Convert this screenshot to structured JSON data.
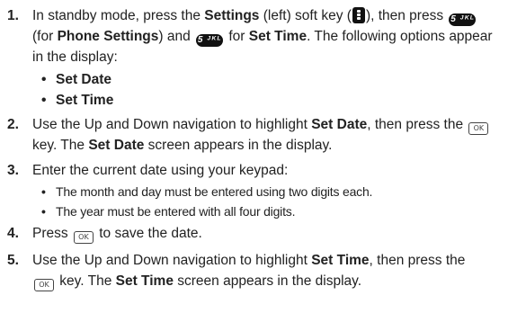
{
  "steps": [
    {
      "num": "1.",
      "parts": {
        "a": "In standby mode, press the ",
        "b": "Settings",
        "c": " (left) soft key (",
        "d": "), then press ",
        "e": "(for ",
        "f": "Phone Settings",
        "g": ") and ",
        "h": " for ",
        "i": "Set Time",
        "j": ". The following options appear",
        "k": "in the display:"
      },
      "bullets": [
        "Set Date",
        "Set Time"
      ]
    },
    {
      "num": "2.",
      "parts": {
        "a": "Use the Up and Down navigation to highlight ",
        "b": "Set Date",
        "c": ", then press the ",
        "d": "key. The ",
        "e": "Set Date",
        "f": " screen appears in the display."
      }
    },
    {
      "num": "3.",
      "text": "Enter the current date using your keypad:",
      "bullets": [
        "The month and day must be entered using two digits each.",
        "The year must be entered with all four digits."
      ]
    },
    {
      "num": "4.",
      "parts": {
        "a": "Press ",
        "b": " to save the date."
      }
    },
    {
      "num": "5.",
      "parts": {
        "a": "Use the Up and Down navigation to highlight ",
        "b": "Set Time",
        "c": ", then press the",
        "d": " key. The ",
        "e": "Set Time",
        "f": " screen appears in the display."
      }
    }
  ],
  "icons": {
    "key5_label": "5 ᴶᴷᴸ",
    "ok_label": "OK",
    "bullet": "•"
  }
}
